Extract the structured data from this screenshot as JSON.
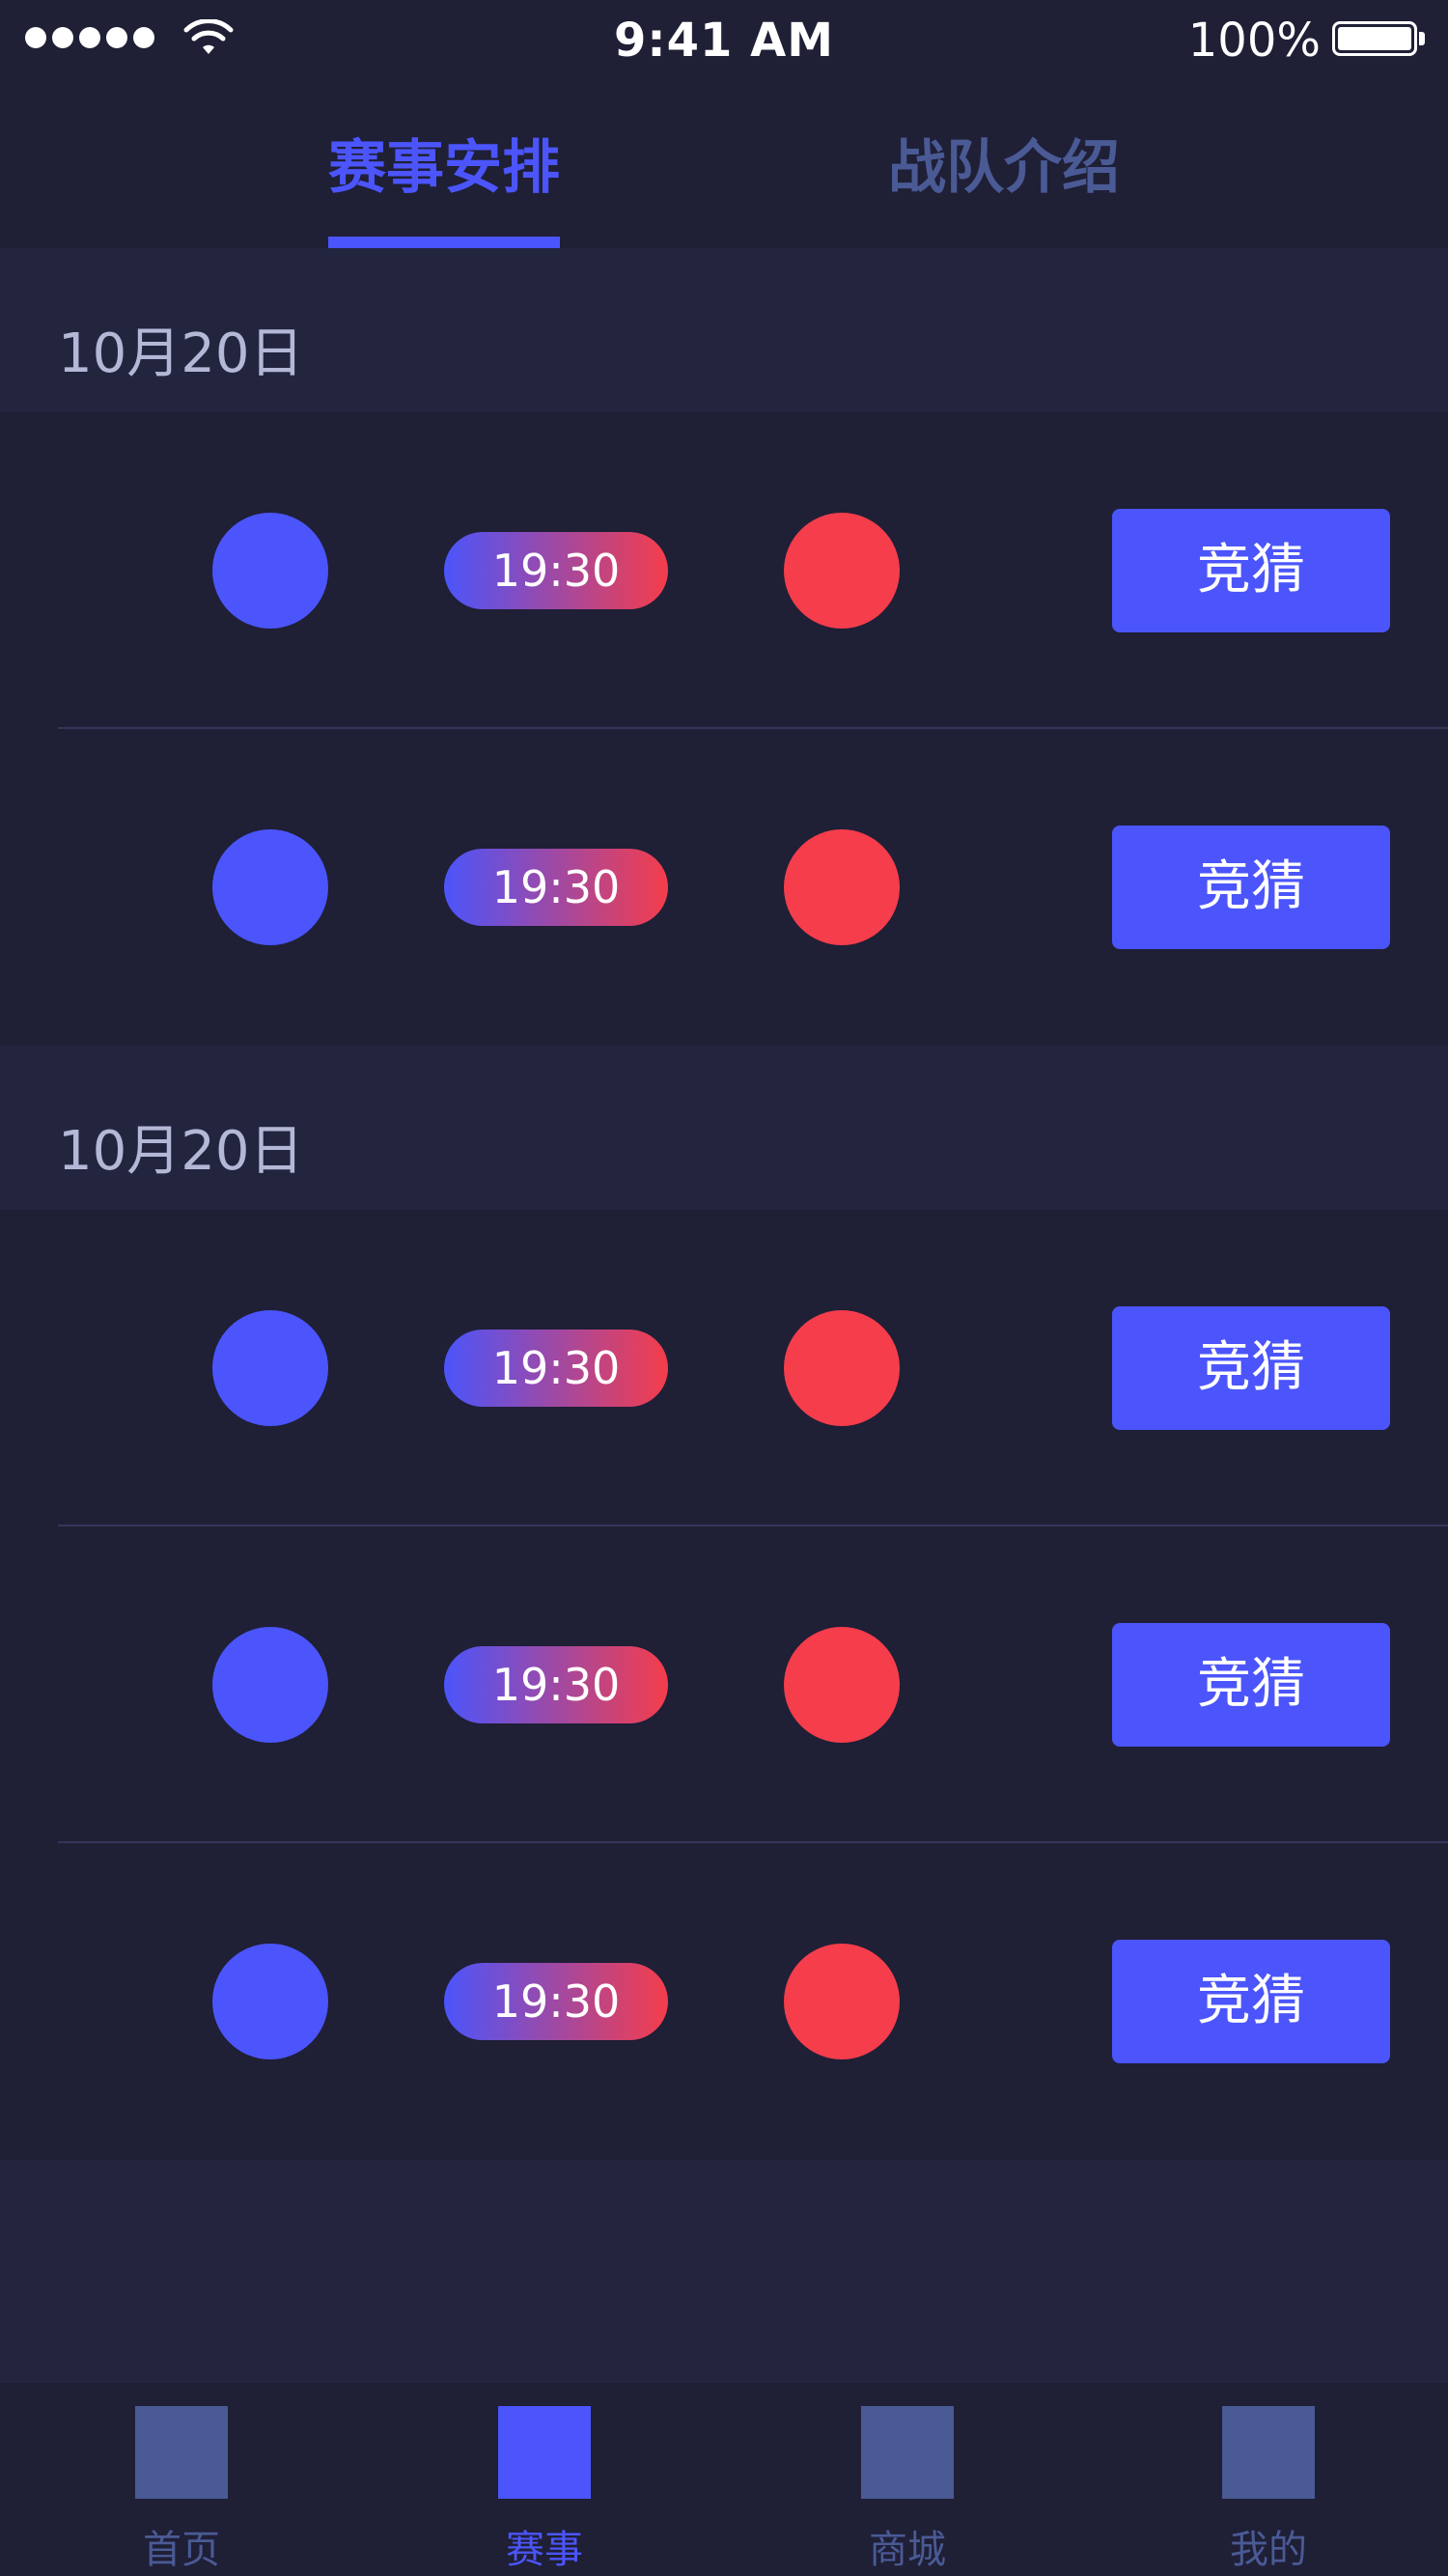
{
  "status_bar": {
    "time": "9:41 AM",
    "battery_percent": "100%",
    "signal_dots": 5,
    "battery_level": 1.0
  },
  "top_tabs": [
    {
      "label": "赛事安排",
      "active": true
    },
    {
      "label": "战队介绍",
      "active": false
    }
  ],
  "sections": [
    {
      "date": "10月20日",
      "matches": [
        {
          "time": "19:30",
          "button": "竞猜"
        },
        {
          "time": "19:30",
          "button": "竞猜"
        }
      ]
    },
    {
      "date": "10月20日",
      "matches": [
        {
          "time": "19:30",
          "button": "竞猜"
        },
        {
          "time": "19:30",
          "button": "竞猜"
        },
        {
          "time": "19:30",
          "button": "竞猜"
        }
      ]
    }
  ],
  "bottom_nav": [
    {
      "label": "首页",
      "active": false
    },
    {
      "label": "赛事",
      "active": true
    },
    {
      "label": "商城",
      "active": false
    },
    {
      "label": "我的",
      "active": false
    }
  ],
  "colors": {
    "background": "#1f1f36",
    "section_header": "#23253f",
    "accent_blue": "#4b55fb",
    "accent_red": "#f53d4b",
    "inactive": "#4a5a95"
  }
}
